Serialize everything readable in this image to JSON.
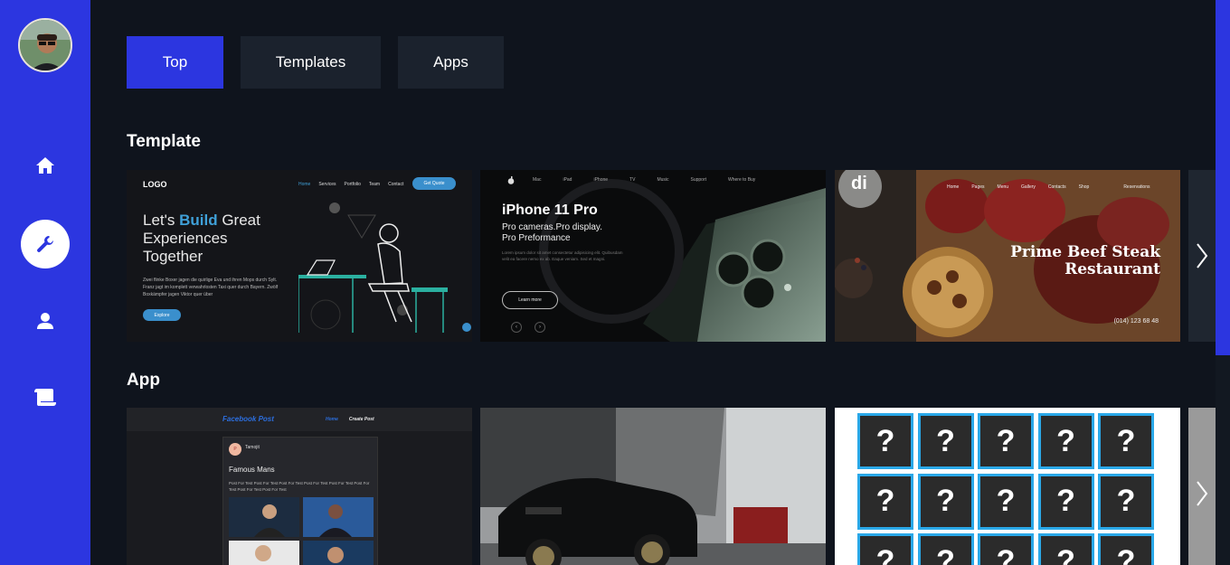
{
  "sidebar": {
    "avatar_alt": "user avatar",
    "items": [
      {
        "icon": "home-icon"
      },
      {
        "icon": "wrench-icon"
      },
      {
        "icon": "user-icon"
      },
      {
        "icon": "scroll-icon"
      }
    ]
  },
  "tabs": [
    {
      "label": "Top"
    },
    {
      "label": "Templates"
    },
    {
      "label": "Apps"
    }
  ],
  "sections": {
    "template_title": "Template",
    "app_title": "App"
  },
  "template_cards": {
    "card1": {
      "logo": "LOGO",
      "nav": [
        "Home",
        "Services",
        "Portfolio",
        "Team",
        "Contact"
      ],
      "cta": "Get Quote",
      "headline_pre": "Let's ",
      "headline_em": "Build",
      "headline_post": " Great",
      "headline_line2": "Experiences",
      "headline_line3": "Together",
      "body": "Zwei flinke Boxer jagen die quirlige Eva und ihren Mops durch Sylt. Franz jagt im komplett verwahrlosten Taxi quer durch Bayern. Zwölf Boxkämpfer jagen Viktor quer über",
      "button": "Explore"
    },
    "card2": {
      "nav": [
        "Mac",
        "iPad",
        "iPhone",
        "TV",
        "Music",
        "Support",
        "Where to Buy"
      ],
      "title": "iPhone 11 Pro",
      "subtitle_line1": "Pro cameras.Pro display.",
      "subtitle_line2": "Pro Preformance",
      "body": "Lorem ipsum dolor sit amet consectetur adipisicing elit. Quibusdam velit ea facere nemo ex ab. Eaque veniam. Sed et magni.",
      "button": "Learn more"
    },
    "card3": {
      "logo": "di",
      "nav": [
        "Home",
        "Pages",
        "Menu",
        "Gallery",
        "Contacts",
        "Shop",
        "Reservations"
      ],
      "title_line1": "Prime Beef Steak",
      "title_line2": "Restaurant",
      "phone": "(014) 123 68 48"
    }
  },
  "app_cards": {
    "card1": {
      "app_title": "Facebook Post",
      "nav": [
        "Home",
        "Create Post"
      ],
      "author": "Tamojit",
      "post_title": "Famous Mans",
      "post_body": "Post For Test Post For Test Post For Test Post For Test Post For Test Post For Test Post For Test Post For Test"
    },
    "card3": {
      "tile_glyph": "?"
    }
  },
  "colors": {
    "accent": "#2c36e0",
    "background": "#0f141d",
    "tab_bg": "#1b222d"
  }
}
